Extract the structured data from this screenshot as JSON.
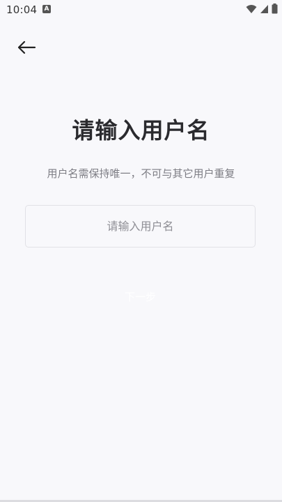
{
  "status_bar": {
    "time": "10:04",
    "notification_icon": "A",
    "icons": [
      "wifi-icon",
      "signal-icon",
      "battery-icon"
    ]
  },
  "header": {
    "back_icon": "arrow-left-icon"
  },
  "main": {
    "title": "请输入用户名",
    "subtitle": "用户名需保持唯一，不可与其它用户重复",
    "username_input": {
      "value": "",
      "placeholder": "请输入用户名"
    },
    "next_button_label": "下一步"
  },
  "colors": {
    "background": "#f8f8fb",
    "title": "#2a2a2e",
    "subtitle": "#7d7d84",
    "input_border": "#e1e1e6"
  }
}
